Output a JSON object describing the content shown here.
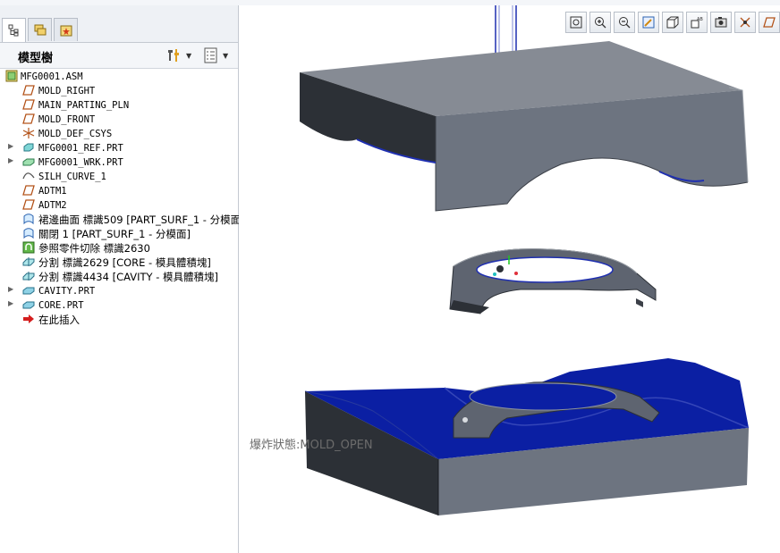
{
  "panel": {
    "title": "模型樹"
  },
  "tree": {
    "items": [
      {
        "label": "MFG0001.ASM",
        "icon": "assembly-icon",
        "expandable": false,
        "level": 0
      },
      {
        "label": "MOLD_RIGHT",
        "icon": "datum-plane-icon",
        "expandable": false,
        "level": 1
      },
      {
        "label": "MAIN_PARTING_PLN",
        "icon": "datum-plane-icon",
        "expandable": false,
        "level": 1
      },
      {
        "label": "MOLD_FRONT",
        "icon": "datum-plane-icon",
        "expandable": false,
        "level": 1
      },
      {
        "label": "MOLD_DEF_CSYS",
        "icon": "csys-icon",
        "expandable": false,
        "level": 1
      },
      {
        "label": "MFG0001_REF.PRT",
        "icon": "ref-part-icon",
        "expandable": true,
        "level": 1
      },
      {
        "label": "MFG0001_WRK.PRT",
        "icon": "workpiece-icon",
        "expandable": true,
        "level": 1
      },
      {
        "label": "SILH_CURVE_1",
        "icon": "curve-icon",
        "expandable": false,
        "level": 1
      },
      {
        "label": "ADTM1",
        "icon": "datum-plane-icon",
        "expandable": false,
        "level": 1
      },
      {
        "label": "ADTM2",
        "icon": "datum-plane-icon",
        "expandable": false,
        "level": 1
      },
      {
        "label": "裙邊曲面 標識509 [PART_SURF_1 - 分模面]",
        "icon": "surface-icon",
        "expandable": false,
        "level": 1
      },
      {
        "label": "關閉 1 [PART_SURF_1 - 分模面]",
        "icon": "surface-icon",
        "expandable": false,
        "level": 1
      },
      {
        "label": "參照零件切除 標識2630",
        "icon": "cutout-icon",
        "expandable": false,
        "level": 1
      },
      {
        "label": "分割 標識2629 [CORE - 模具體積塊]",
        "icon": "split-icon",
        "expandable": false,
        "level": 1
      },
      {
        "label": "分割 標識4434 [CAVITY - 模具體積塊]",
        "icon": "split-icon",
        "expandable": false,
        "level": 1
      },
      {
        "label": "CAVITY.PRT",
        "icon": "mold-part-icon",
        "expandable": true,
        "level": 1
      },
      {
        "label": "CORE.PRT",
        "icon": "mold-part-icon",
        "expandable": true,
        "level": 1
      },
      {
        "label": "在此插入",
        "icon": "insert-here-arrow-icon",
        "expandable": false,
        "level": 1
      }
    ]
  },
  "viewport": {
    "status_text": "爆炸狀態:MOLD_OPEN"
  },
  "view_toolbar": {
    "buttons": [
      "refit-icon",
      "zoom-in-icon",
      "zoom-out-icon",
      "repaint-icon",
      "display-style-icon",
      "saved-views-icon",
      "view-manager-icon",
      "datum-display-icon",
      "spin-center-icon"
    ]
  },
  "colors": {
    "accent_blue": "#1f2fb0",
    "block_gray": "#6d7480",
    "block_top": "#868b94",
    "block_dark": "#2c3036"
  }
}
